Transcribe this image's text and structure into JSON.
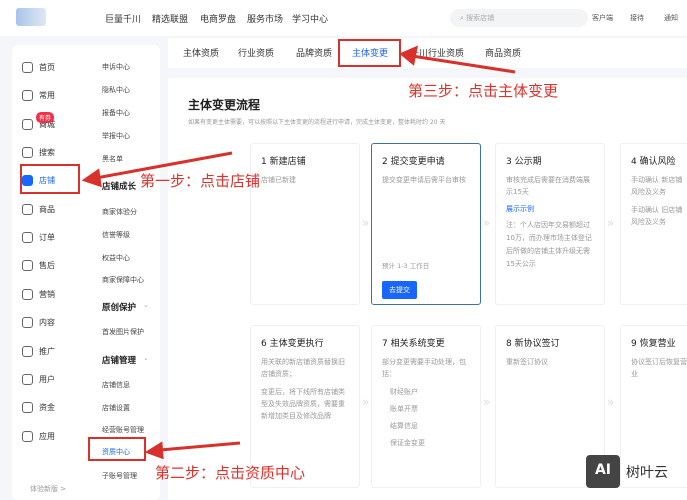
{
  "topnav": {
    "items": [
      "巨量千川",
      "精选联盟",
      "电商罗盘",
      "服务市场",
      "学习中心"
    ],
    "search_placeholder": "搜索店铺",
    "right": [
      "客户端",
      "接待",
      "通知"
    ]
  },
  "sidebar": {
    "primary": [
      "首页",
      "常用",
      "商城",
      "搜索",
      "店铺",
      "商品",
      "订单",
      "售后",
      "营销",
      "内容",
      "推广",
      "用户",
      "资金",
      "应用"
    ],
    "badge": "有券",
    "footer": "体验新版 >",
    "secondary": [
      {
        "t": "item",
        "l": "申诉中心"
      },
      {
        "t": "item",
        "l": "隐私中心"
      },
      {
        "t": "item",
        "l": "报备中心"
      },
      {
        "t": "item",
        "l": "举报中心"
      },
      {
        "t": "item",
        "l": "黑名单"
      },
      {
        "t": "head",
        "l": "店铺成长"
      },
      {
        "t": "item",
        "l": "商家体验分"
      },
      {
        "t": "item",
        "l": "信誉等级"
      },
      {
        "t": "item",
        "l": "权益中心"
      },
      {
        "t": "item",
        "l": "商家保障中心"
      },
      {
        "t": "head",
        "l": "原创保护"
      },
      {
        "t": "item",
        "l": "首发图片保护"
      },
      {
        "t": "head",
        "l": "店铺管理"
      },
      {
        "t": "item",
        "l": "店铺信息"
      },
      {
        "t": "item",
        "l": "店铺设置"
      },
      {
        "t": "item",
        "l": "经营账号管理"
      },
      {
        "t": "item",
        "l": "资质中心"
      },
      {
        "t": "item",
        "l": "子账号管理"
      }
    ]
  },
  "tabs": [
    "主体资质",
    "行业资质",
    "品牌资质",
    "主体变更",
    "千川行业资质",
    "商品资质"
  ],
  "main": {
    "title": "主体变更流程",
    "desc": "如果有变更主体需要，可以按照以下主体变更的流程进行申请，完成主体变更，整体耗时约 20 天",
    "steps": [
      {
        "title": "1 新建店铺",
        "items": [
          "店铺已新建"
        ]
      },
      {
        "title": "2 提交变更申请",
        "items": [
          "提交变更申请后需平台审核"
        ],
        "eta": "预计 1-3 工作日",
        "button": "去提交"
      },
      {
        "title": "3 公示期",
        "items": [
          "审核完成后需要在消费端展示15天"
        ],
        "link": "展示示例",
        "note": "注：个人店因年交易额超过10万，而办理市场主体登记后所做的店铺主体升级无需15天公示"
      },
      {
        "title": "4 确认风险",
        "items": [
          "手动确认 新店铺风险及义务",
          "手动确认 旧店铺风险及义务"
        ]
      },
      {
        "title": "6 主体变更执行",
        "items": [
          "用关联的新店铺资质替换旧店铺资质；",
          "变更后，将下线所有店铺类型及失效品牌资质，需要重新增加类目及修改品牌"
        ]
      },
      {
        "title": "7 相关系统变更",
        "items": [
          "部分变更需要手动处理，包括："
        ],
        "subs": [
          "财经账户",
          "账单开票",
          "结算信息",
          "保证金变更"
        ]
      },
      {
        "title": "8 新协议签订",
        "items": [
          "重新签订协议"
        ]
      },
      {
        "title": "9 恢复营业",
        "items": [
          "协议签订后恢复营业"
        ]
      }
    ]
  },
  "annotations": {
    "step1": "第一步：点击店铺",
    "step2": "第二步：点击资质中心",
    "step3": "第三步：点击主体变更"
  },
  "watermark": {
    "logo": "AI",
    "text": "树叶云"
  }
}
